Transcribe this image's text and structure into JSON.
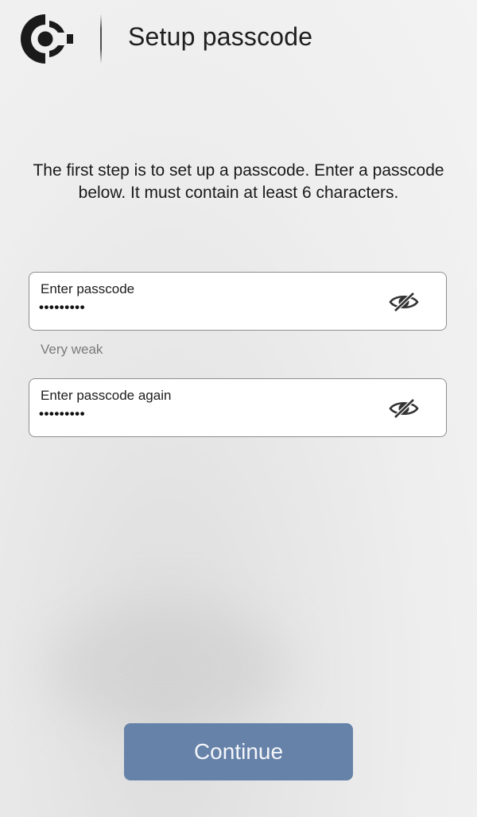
{
  "header": {
    "logo_icon": "logo-icon",
    "title": "Setup passcode"
  },
  "instructions": "The first step is to set up a passcode. Enter a passcode below. It must contain at least 6 characters.",
  "passcode_field": {
    "label": "Enter passcode",
    "value": "•••••••••",
    "toggle_icon": "eye-off-icon"
  },
  "strength": {
    "text": "Very weak"
  },
  "confirm_field": {
    "label": "Enter passcode again",
    "value": "•••••••••",
    "toggle_icon": "eye-off-icon"
  },
  "continue_button": {
    "label": "Continue"
  },
  "colors": {
    "accent": "#6682a8",
    "field_border": "#8e8e8e",
    "strength_text": "#7a7a7a"
  }
}
